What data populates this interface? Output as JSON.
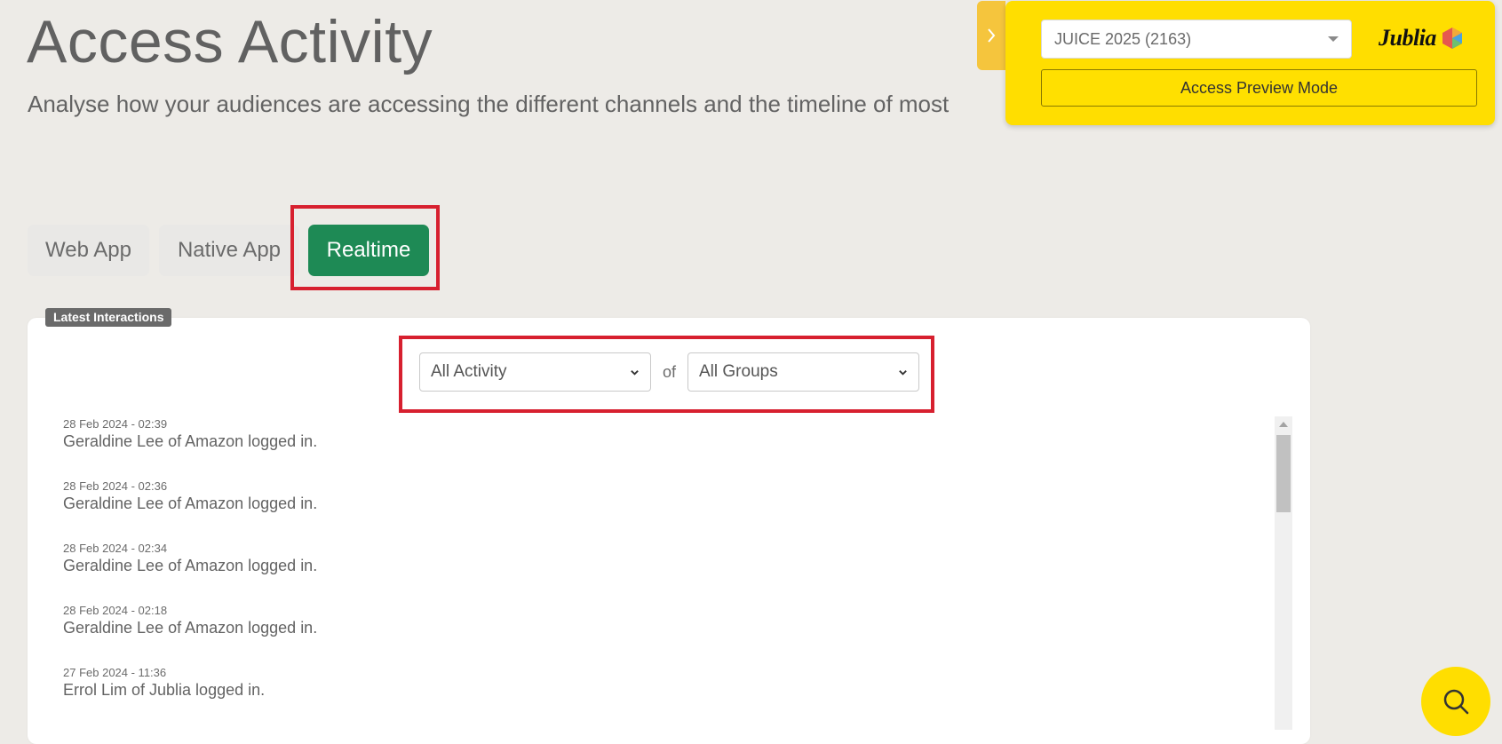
{
  "header": {
    "title": "Access Activity",
    "subtitle": "Analyse how your audiences are accessing the different channels and the timeline of most"
  },
  "tabs": [
    {
      "label": "Web App",
      "active": false
    },
    {
      "label": "Native App",
      "active": false
    },
    {
      "label": "Realtime",
      "active": true
    }
  ],
  "panel": {
    "badge": "Latest Interactions",
    "filters": {
      "activity": "All Activity",
      "connector": "of",
      "groups": "All Groups"
    },
    "items": [
      {
        "time": "28 Feb 2024 - 02:39",
        "message": "Geraldine Lee of Amazon logged in."
      },
      {
        "time": "28 Feb 2024 - 02:36",
        "message": "Geraldine Lee of Amazon logged in."
      },
      {
        "time": "28 Feb 2024 - 02:34",
        "message": "Geraldine Lee of Amazon logged in."
      },
      {
        "time": "28 Feb 2024 - 02:18",
        "message": "Geraldine Lee of Amazon logged in."
      },
      {
        "time": "27 Feb 2024 - 11:36",
        "message": "Errol Lim of Jublia logged in."
      }
    ]
  },
  "widget": {
    "event": "JUICE 2025 (2163)",
    "preview_button": "Access Preview Mode",
    "logo_text": "Jublia"
  },
  "colors": {
    "accent_green": "#1e8a55",
    "highlight_red": "#d7202f",
    "widget_yellow": "#ffde00"
  },
  "icons": {
    "toggle": "chevron-right-icon",
    "event_dropdown": "caret-down-icon",
    "filter_dropdown": "chevron-down-icon",
    "fab": "search-icon",
    "logo": "jublia-logo-icon"
  }
}
